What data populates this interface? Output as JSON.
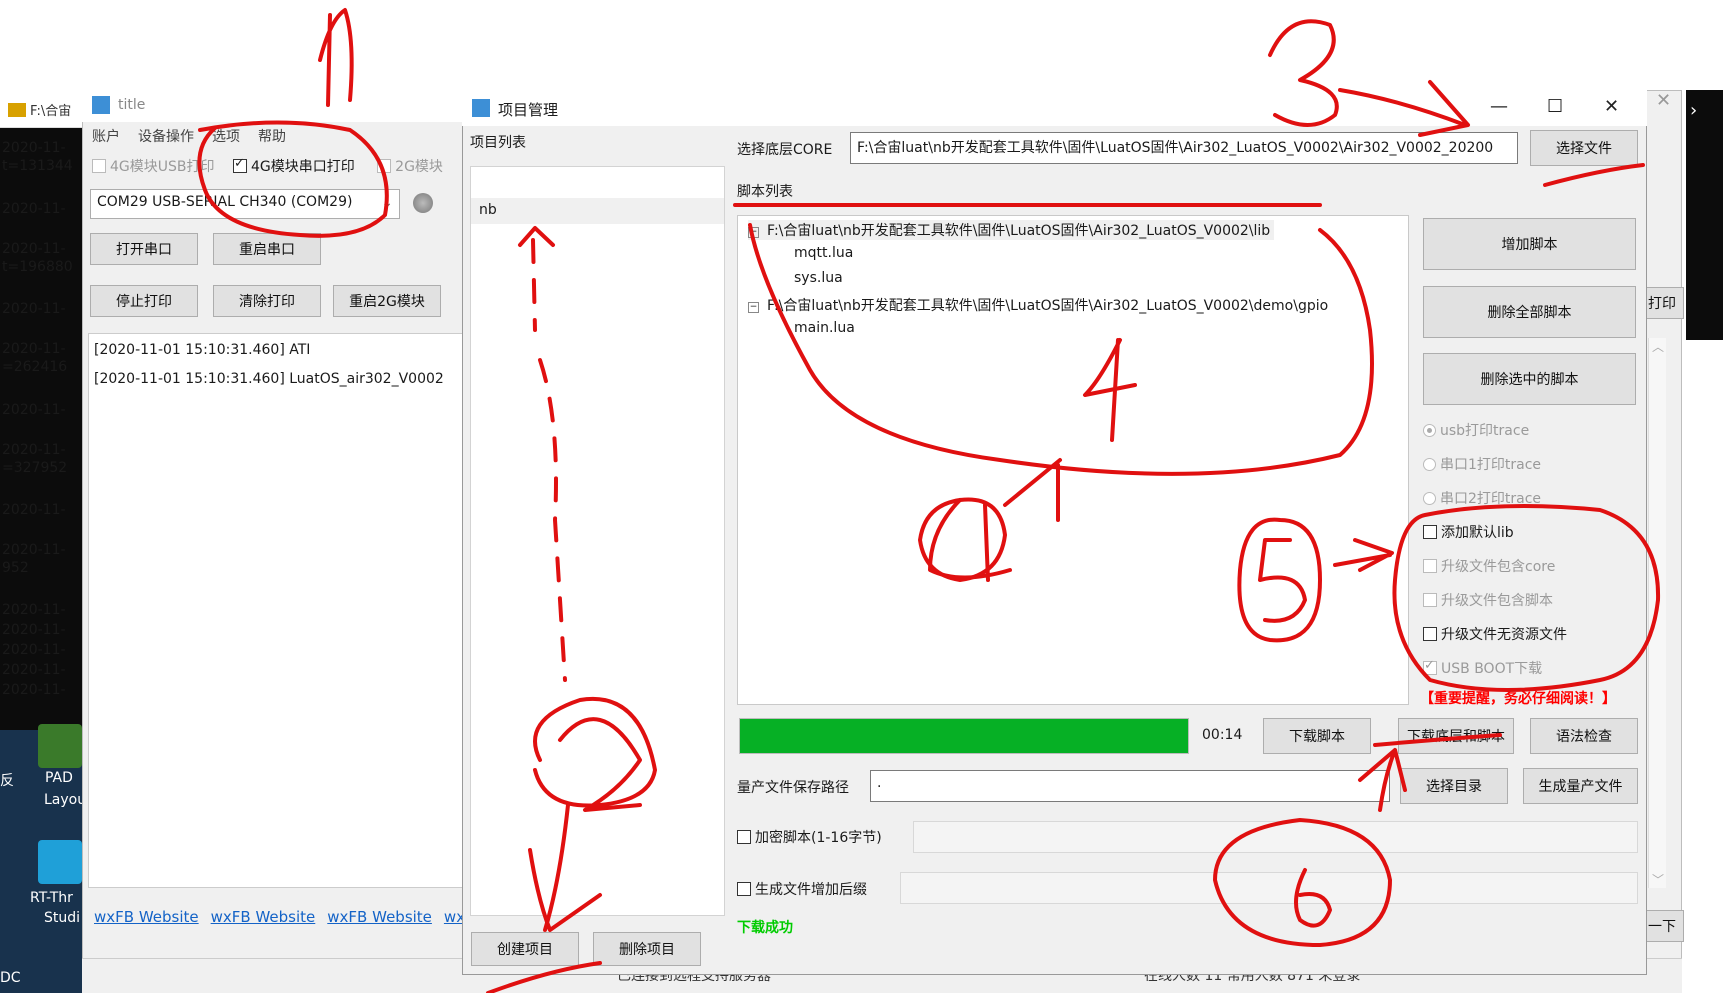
{
  "console": {
    "title": "F:\\合宙",
    "lines": [
      "2020-11-",
      "t=131344",
      "2020-11-",
      "2020-11-",
      "t=196880",
      "2020-11-",
      "2020-11-",
      "=262416",
      "2020-11-",
      "2020-11-",
      "=327952",
      "2020-11-",
      "2020-11-",
      "952",
      "2020-11-",
      "2020-11-",
      "2020-11-",
      "2020-11-",
      "2020-11-"
    ]
  },
  "desktop": {
    "icons": [
      {
        "label1": "PAD",
        "label2": "Layou",
        "color": "#3a7a2a"
      },
      {
        "label1": "RT-Thr",
        "label2": "Studi",
        "color": "#1fa0d8"
      }
    ],
    "edge_text": [
      "反",
      "DC"
    ]
  },
  "back_window": {
    "title": "title",
    "menu": [
      "账户",
      "设备操作",
      "选项",
      "帮助"
    ],
    "checkboxes": [
      {
        "label": "4G模块USB打印",
        "checked": false,
        "enabled": false
      },
      {
        "label": "4G模块串口打印",
        "checked": true,
        "enabled": true
      },
      {
        "label": "2G模块",
        "checked": false,
        "enabled": false
      }
    ],
    "port_select": "COM29 USB-SERIAL CH340 (COM29)",
    "buttons": [
      "打开串口",
      "重启串口",
      "停止打印",
      "清除打印",
      "重启2G模块"
    ],
    "log": [
      "[2020-11-01 15:10:31.460] ATI",
      "[2020-11-01 15:10:31.460] LuatOS_air302_V0002"
    ],
    "links": [
      "wxFB Website",
      "wxFB Website",
      "wxFB Website",
      "wxF"
    ],
    "right_partial_button": "打印",
    "right_partial_button2": "一下",
    "status_left": "已连接到远程支持服务器",
    "status_right": "在线人数 11 常用人数 871 未登录"
  },
  "dialog": {
    "title": "项目管理",
    "project_list_label": "项目列表",
    "projects": [
      "nb"
    ],
    "create_button": "创建项目",
    "delete_button": "删除项目",
    "core_label": "选择底层CORE",
    "core_path": "F:\\合宙luat\\nb开发配套工具软件\\固件\\LuatOS固件\\Air302_LuatOS_V0002\\Air302_V0002_20200",
    "choose_file_button": "选择文件",
    "script_list_label": "脚本列表",
    "tree": [
      {
        "type": "folder",
        "text": "F:\\合宙luat\\nb开发配套工具软件\\固件\\LuatOS固件\\Air302_LuatOS_V0002\\lib"
      },
      {
        "type": "file",
        "text": "mqtt.lua"
      },
      {
        "type": "file",
        "text": "sys.lua"
      },
      {
        "type": "folder",
        "text": "F:\\合宙luat\\nb开发配套工具软件\\固件\\LuatOS固件\\Air302_LuatOS_V0002\\demo\\gpio"
      },
      {
        "type": "file",
        "text": "main.lua"
      }
    ],
    "side_buttons": [
      "增加脚本",
      "删除全部脚本",
      "删除选中的脚本"
    ],
    "radios": [
      {
        "label": "usb打印trace",
        "selected": true
      },
      {
        "label": "串口1打印trace",
        "selected": false
      },
      {
        "label": "串口2打印trace",
        "selected": false
      }
    ],
    "options": [
      {
        "label": "添加默认lib",
        "checked": false,
        "enabled": true
      },
      {
        "label": "升级文件包含core",
        "checked": false,
        "enabled": false
      },
      {
        "label": "升级文件包含脚本",
        "checked": false,
        "enabled": false
      },
      {
        "label": "升级文件无资源文件",
        "checked": false,
        "enabled": true
      },
      {
        "label": "USB BOOT下载",
        "checked": true,
        "enabled": false
      }
    ],
    "warning": "【重要提醒，务必仔细阅读！】",
    "progress_percent": 100,
    "elapsed": "00:14",
    "download_script_button": "下载脚本",
    "download_core_script_button": "下载底层和脚本",
    "syntax_check_button": "语法检查",
    "save_path_label": "量产文件保存路径",
    "save_path_value": ".",
    "choose_dir_button": "选择目录",
    "gen_file_button": "生成量产文件",
    "encrypt_label": "加密脚本(1-16字节)",
    "suffix_label": "生成文件增加后缀",
    "status": "下载成功",
    "status_color": "#00cc00",
    "warning_color": "#ff0000"
  },
  "annotations": {
    "color": "#e01010",
    "numbers": [
      "1",
      "2",
      "3",
      "4",
      "4",
      "5",
      "6"
    ]
  }
}
